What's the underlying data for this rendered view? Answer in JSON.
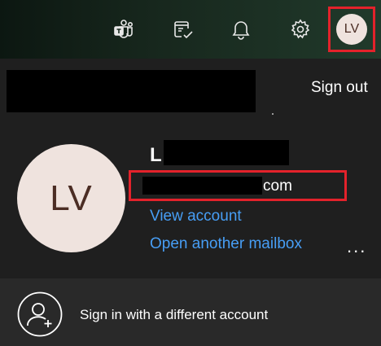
{
  "topbar": {
    "icons": [
      "teams-icon",
      "my-day-icon",
      "notifications-bell-icon",
      "settings-gear-icon"
    ],
    "avatar_initials": "LV"
  },
  "account": {
    "sign_out_label": "Sign out",
    "avatar_initials": "LV",
    "name_visible": "L",
    "email_visible_suffix": "com",
    "view_account_label": "View account",
    "open_mailbox_label": "Open another mailbox",
    "more_options_label": "..."
  },
  "footer": {
    "icon": "add-person-icon",
    "sign_in_label": "Sign in with a different account"
  },
  "colors": {
    "link": "#479ef5",
    "highlight": "#e3222b",
    "avatar_bg": "#efe3de",
    "avatar_text": "#4b2d24"
  }
}
